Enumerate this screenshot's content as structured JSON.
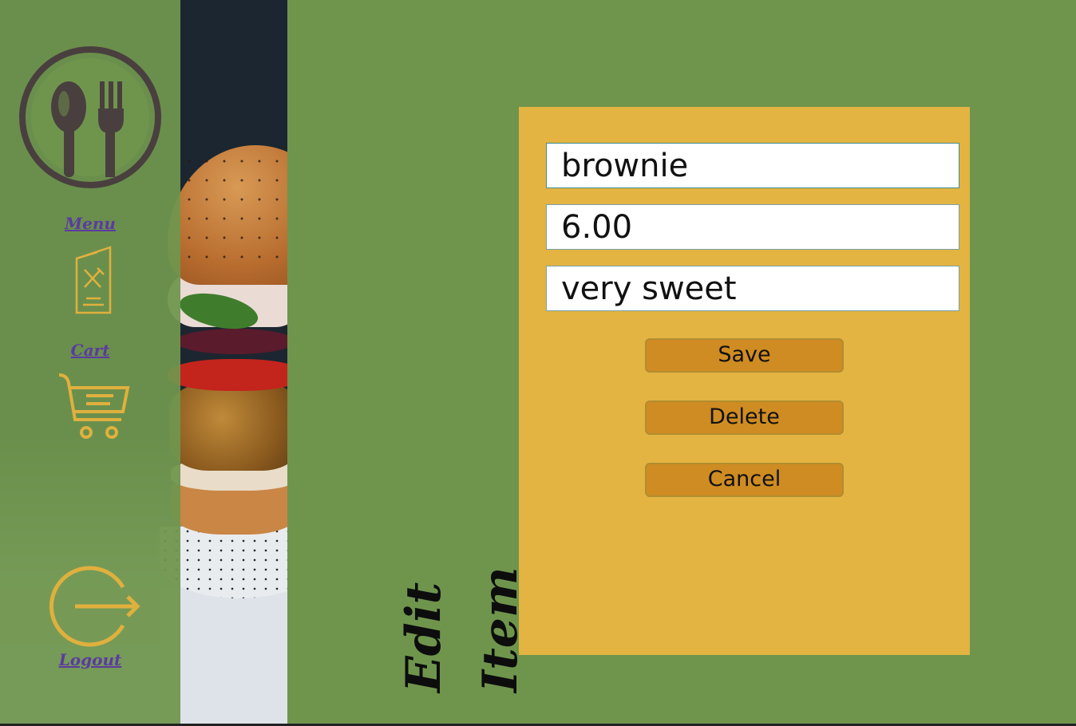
{
  "sidebar": {
    "menu_label": "Menu",
    "cart_label": "Cart",
    "logout_label": "Logout"
  },
  "page": {
    "title_word_1": "Edit",
    "title_word_2": "Item"
  },
  "form": {
    "name_value": "brownie",
    "price_value": "6.00",
    "description_value": "very sweet",
    "save_label": "Save",
    "delete_label": "Delete",
    "cancel_label": "Cancel"
  },
  "colors": {
    "background": "#6f954d",
    "panel": "#e3b441",
    "button": "#cf8c22",
    "icon_accent": "#e0b03e",
    "link": "#5b3ba0"
  },
  "icons": [
    "restaurant-logo-icon",
    "menu-icon",
    "cart-icon",
    "logout-icon"
  ]
}
